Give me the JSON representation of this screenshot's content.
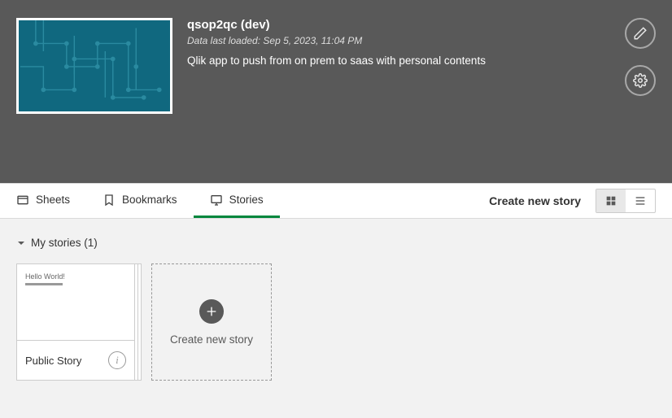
{
  "header": {
    "title": "qsop2qc (dev)",
    "last_loaded": "Data last loaded: Sep 5, 2023, 11:04 PM",
    "description": "Qlik app to push from on prem to saas with personal contents"
  },
  "tabs": {
    "sheets": "Sheets",
    "bookmarks": "Bookmarks",
    "stories": "Stories"
  },
  "toolbar": {
    "create_story": "Create new story"
  },
  "section": {
    "my_stories": "My stories (1)"
  },
  "stories": [
    {
      "preview_text": "Hello World!",
      "title": "Public Story"
    }
  ],
  "create_card": "Create new story"
}
